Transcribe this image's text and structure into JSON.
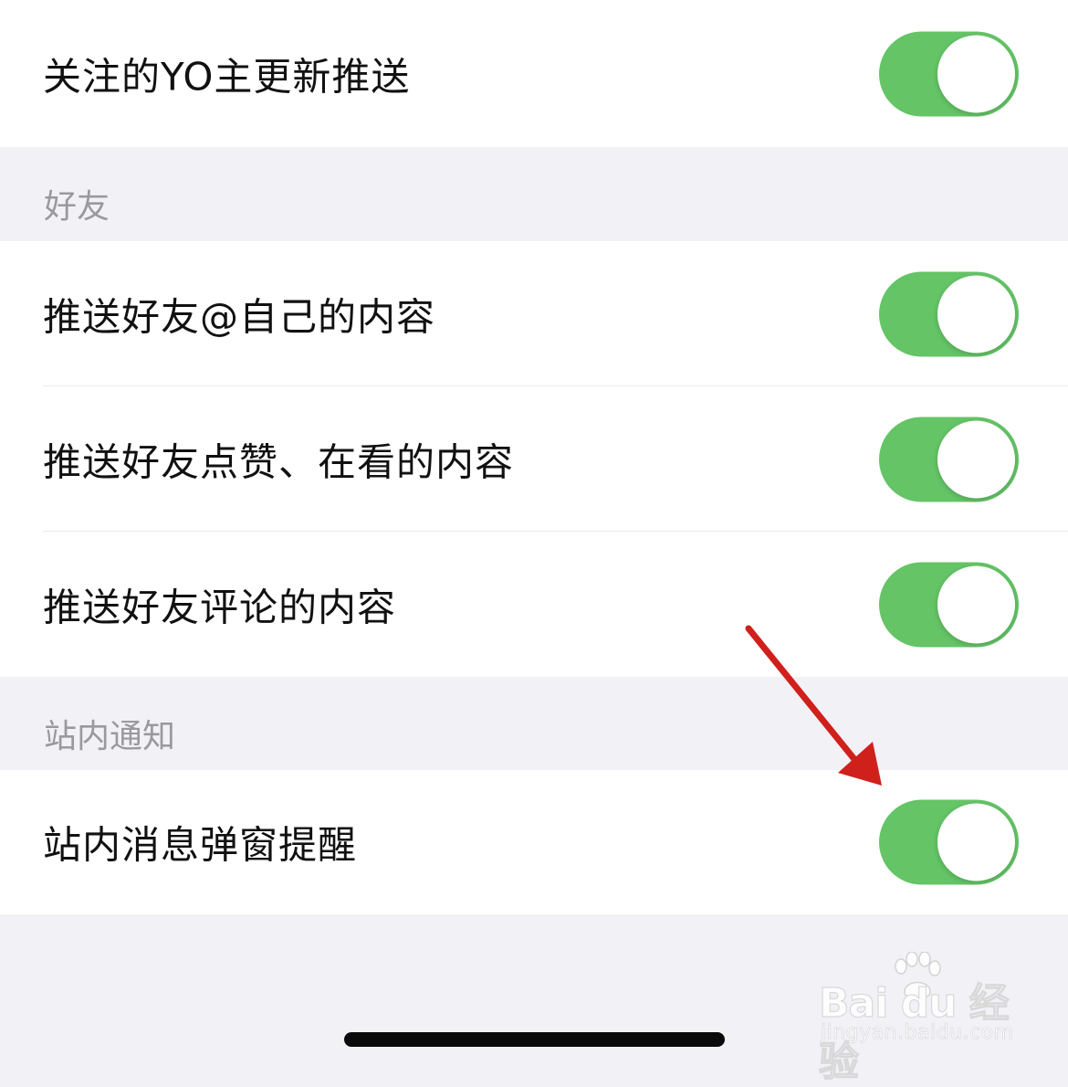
{
  "groups": {
    "top": {
      "items": [
        {
          "label": "关注的YO主更新推送",
          "on": true
        }
      ]
    },
    "friends": {
      "header": "好友",
      "items": [
        {
          "label": "推送好友@自己的内容",
          "on": true
        },
        {
          "label": "推送好友点赞、在看的内容",
          "on": true
        },
        {
          "label": "推送好友评论的内容",
          "on": true
        }
      ]
    },
    "site_notice": {
      "header": "站内通知",
      "items": [
        {
          "label": "站内消息弹窗提醒",
          "on": true
        }
      ]
    }
  },
  "colors": {
    "toggle_on": "#64c466",
    "background": "#f2f1f6",
    "annotation_arrow": "#d0201c"
  },
  "watermark": {
    "brand_text": "Bai du 经验",
    "url": "jingyan.baidu.com",
    "icon": "baidu-paw-icon"
  }
}
